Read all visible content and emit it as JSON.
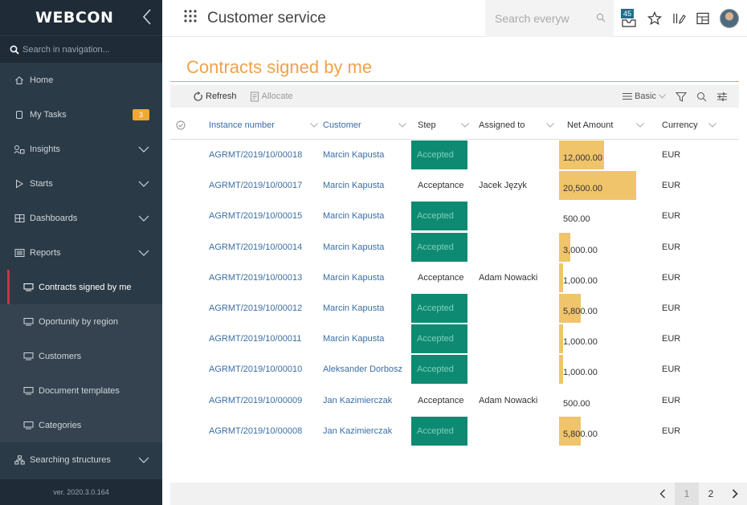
{
  "brand": {
    "logo": "WEBCON"
  },
  "nav": {
    "search_placeholder": "Search in navigation...",
    "items": [
      {
        "label": "Home",
        "icon": "home-icon"
      },
      {
        "label": "My Tasks",
        "icon": "tasks-icon",
        "badge": "3"
      },
      {
        "label": "Insights",
        "icon": "insights-icon"
      },
      {
        "label": "Starts",
        "icon": "play-icon"
      },
      {
        "label": "Dashboards",
        "icon": "dashboard-icon"
      },
      {
        "label": "Reports",
        "icon": "reports-icon"
      }
    ],
    "reports": [
      {
        "label": "Contracts signed by me",
        "active": true
      },
      {
        "label": "Oportunity by region"
      },
      {
        "label": "Customers"
      },
      {
        "label": "Document templates"
      },
      {
        "label": "Categories"
      }
    ],
    "searching": "Searching structures",
    "version": "ver. 2020.3.0.164"
  },
  "header": {
    "title": "Customer service",
    "search_placeholder": "Search everyw",
    "notifications": "45"
  },
  "page": {
    "title": "Contracts signed by me"
  },
  "toolbar": {
    "refresh": "Refresh",
    "allocate": "Allocate",
    "view": "Basic"
  },
  "columns": {
    "instance": "Instance number",
    "customer": "Customer",
    "step": "Step",
    "assigned": "Assigned to",
    "net": "Net Amount",
    "currency": "Currency"
  },
  "rows": [
    {
      "instance": "AGRMT/2019/10/00018",
      "customer": "Marcin Kapusta",
      "step": "Accepted",
      "accepted": true,
      "assigned": "",
      "net": "12,000.00",
      "net_value": 12000,
      "currency": "EUR"
    },
    {
      "instance": "AGRMT/2019/10/00017",
      "customer": "Marcin Kapusta",
      "step": "Acceptance",
      "accepted": false,
      "assigned": "Jacek Język",
      "net": "20,500.00",
      "net_value": 20500,
      "currency": "EUR"
    },
    {
      "instance": "AGRMT/2019/10/00015",
      "customer": "Marcin Kapusta",
      "step": "Accepted",
      "accepted": true,
      "assigned": "",
      "net": "500.00",
      "net_value": 500,
      "currency": "EUR"
    },
    {
      "instance": "AGRMT/2019/10/00014",
      "customer": "Marcin Kapusta",
      "step": "Accepted",
      "accepted": true,
      "assigned": "",
      "net": "3,000.00",
      "net_value": 3000,
      "currency": "EUR"
    },
    {
      "instance": "AGRMT/2019/10/00013",
      "customer": "Marcin Kapusta",
      "step": "Acceptance",
      "accepted": false,
      "assigned": "Adam Nowacki",
      "net": "1,000.00",
      "net_value": 1000,
      "currency": "EUR"
    },
    {
      "instance": "AGRMT/2019/10/00012",
      "customer": "Marcin Kapusta",
      "step": "Accepted",
      "accepted": true,
      "assigned": "",
      "net": "5,800.00",
      "net_value": 5800,
      "currency": "EUR"
    },
    {
      "instance": "AGRMT/2019/10/00011",
      "customer": "Marcin Kapusta",
      "step": "Accepted",
      "accepted": true,
      "assigned": "",
      "net": "1,000.00",
      "net_value": 1000,
      "currency": "EUR"
    },
    {
      "instance": "AGRMT/2019/10/00010",
      "customer": "Aleksander Dorbosz",
      "step": "Accepted",
      "accepted": true,
      "assigned": "",
      "net": "1,000.00",
      "net_value": 1000,
      "currency": "EUR"
    },
    {
      "instance": "AGRMT/2019/10/00009",
      "customer": "Jan Kazimierczak",
      "step": "Acceptance",
      "accepted": false,
      "assigned": "Adam Nowacki",
      "net": "500.00",
      "net_value": 500,
      "currency": "EUR"
    },
    {
      "instance": "AGRMT/2019/10/00008",
      "customer": "Jan Kazimierczak",
      "step": "Accepted",
      "accepted": true,
      "assigned": "",
      "net": "5,800.00",
      "net_value": 5800,
      "currency": "EUR"
    }
  ],
  "net_max": 20500,
  "pager": {
    "current": "1",
    "next_page": "2"
  },
  "colors": {
    "accent": "#f0a24a",
    "accepted": "#0f8a72",
    "bar": "#f0c46a",
    "sidebar": "#2b3a47"
  }
}
